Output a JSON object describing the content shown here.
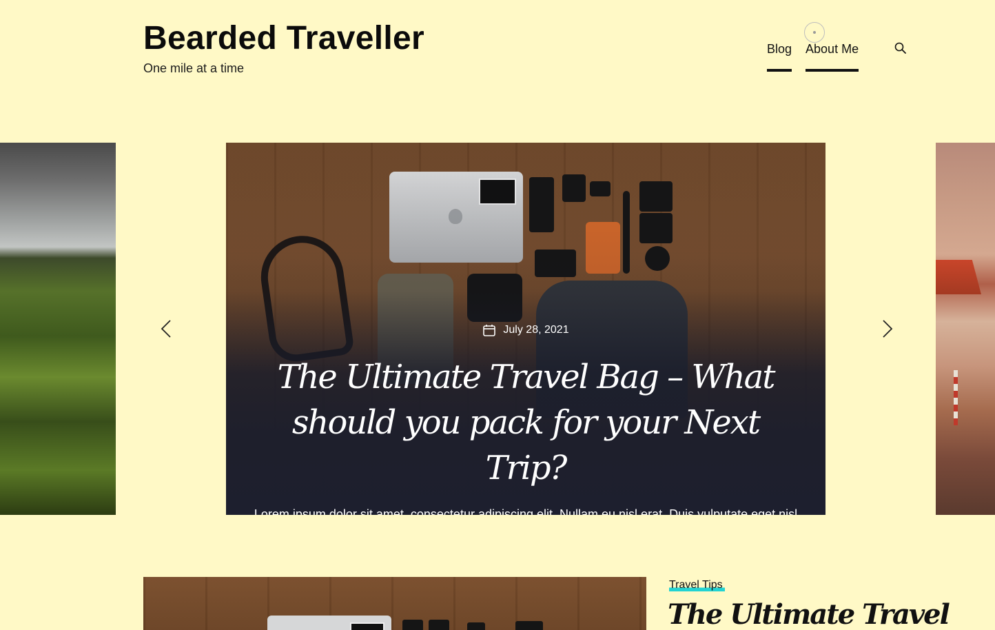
{
  "site": {
    "title": "Bearded Traveller",
    "tagline": "One mile at a time"
  },
  "nav": {
    "items": [
      {
        "label": "Blog"
      },
      {
        "label": "About Me"
      }
    ],
    "search_icon": "search-icon"
  },
  "slider": {
    "prev_icon": "chevron-left-icon",
    "next_icon": "chevron-right-icon",
    "active": {
      "date": "July 28, 2021",
      "date_icon": "calendar-icon",
      "title": "The Ultimate Travel Bag – What should you pack for your Next Trip?",
      "excerpt": "Lorem ipsum dolor sit amet, consectetur adipiscing elit. Nullam eu nisl erat. Duis vulputate eget nisl sit amet dignissim. Ut accumsan neque a ipsum faucibus,..."
    }
  },
  "post": {
    "category": "Travel Tips",
    "title": "The Ultimate Travel"
  },
  "colors": {
    "background": "#fff9c6",
    "accent_underline": "#22d3d3",
    "slide_overlay": "#1d1f2e"
  }
}
